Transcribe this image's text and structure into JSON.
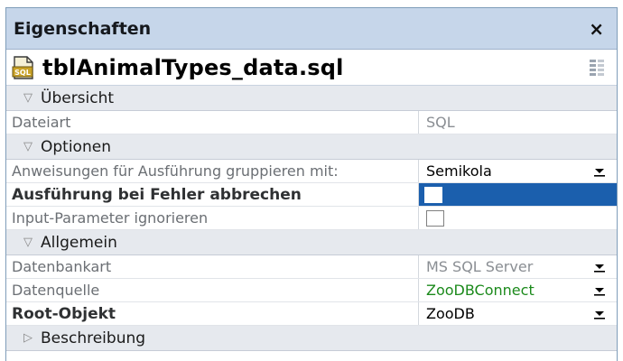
{
  "window": {
    "title": "Eigenschaften",
    "close_glyph": "×",
    "close_icon": "close-icon"
  },
  "file": {
    "name": "tblAnimalTypes_data.sql",
    "icon": "sql-file-icon",
    "icon_text": "SQL"
  },
  "sections": [
    {
      "label": "Übersicht",
      "expanded": true
    },
    {
      "label": "Optionen",
      "expanded": true
    },
    {
      "label": "Allgemein",
      "expanded": true
    },
    {
      "label": "Beschreibung",
      "expanded": false
    }
  ],
  "rows": {
    "dateiart": {
      "label": "Dateiart",
      "value": "SQL"
    },
    "anweisungen": {
      "label": "Anweisungen für Ausführung gruppieren mit:",
      "value": "Semikola"
    },
    "abbrechen": {
      "label": "Ausführung bei Fehler abbrechen",
      "checked": false,
      "selected": true
    },
    "input": {
      "label": "Input-Parameter ignorieren",
      "checked": false
    },
    "datenbankart": {
      "label": "Datenbankart",
      "value": "MS SQL Server"
    },
    "datenquelle": {
      "label": "Datenquelle",
      "value": "ZooDBConnect"
    },
    "root": {
      "label": "Root-Objekt",
      "value": "ZooDB"
    }
  },
  "colors": {
    "titlebar": "#c6d6ea",
    "section": "#e6e9ee",
    "selection": "#1b5fad",
    "datasource_text": "#1c8a1c"
  }
}
